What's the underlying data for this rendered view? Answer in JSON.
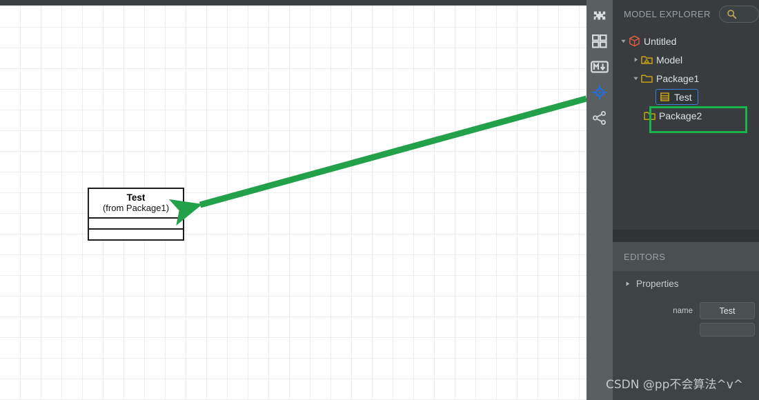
{
  "canvas": {
    "class_box": {
      "name": "Test",
      "qualifier": "(from Package1)"
    },
    "annotation": {
      "arrow_color": "#22a14a"
    },
    "grid_color": "#ececec",
    "topbar_color": "#3a3f42"
  },
  "toolbar": {
    "items": [
      {
        "icon": "puzzle-piece-icon",
        "label": "Extensions",
        "active": false
      },
      {
        "icon": "grid-squares-icon",
        "label": "Diagram Layout",
        "active": false
      },
      {
        "icon": "markdown-icon",
        "label": "Markdown",
        "active": false
      },
      {
        "icon": "crosshair-target-icon",
        "label": "Locate",
        "active": true
      },
      {
        "icon": "share-nodes-icon",
        "label": "Relationships",
        "active": false
      }
    ]
  },
  "explorer": {
    "title": "MODEL EXPLORER",
    "search_icon": "search-icon",
    "search_placeholder": "",
    "search_value": "",
    "tree": [
      {
        "label": "Untitled",
        "icon": "cube-icon",
        "expanded": true,
        "twisty": "down",
        "depth": 0,
        "selected": false
      },
      {
        "label": "Model",
        "icon": "model-folder-icon",
        "expanded": false,
        "twisty": "right",
        "depth": 1,
        "selected": false
      },
      {
        "label": "Package1",
        "icon": "folder-icon",
        "expanded": true,
        "twisty": "down",
        "depth": 1,
        "selected": false
      },
      {
        "label": "Test",
        "icon": "class-icon",
        "expanded": false,
        "twisty": "none",
        "depth": 2,
        "selected": true
      },
      {
        "label": "Package2",
        "icon": "folder-icon",
        "expanded": false,
        "twisty": "none",
        "depth": 1,
        "selected": false
      }
    ],
    "highlight_color": "#18b34a"
  },
  "editors": {
    "title": "EDITORS",
    "properties_label": "Properties",
    "properties_twisty": "right",
    "fields": [
      {
        "label": "name",
        "value": "Test"
      }
    ]
  },
  "watermark": {
    "text": "CSDN @pp不会算法^v^"
  },
  "colors": {
    "panel_bg": "#383c3e",
    "rail_bg": "#5a5f61",
    "accent_blue": "#3d7fd4",
    "accent_yellow": "#c8a415",
    "accent_red": "#e05a43",
    "green": "#18b34a"
  }
}
